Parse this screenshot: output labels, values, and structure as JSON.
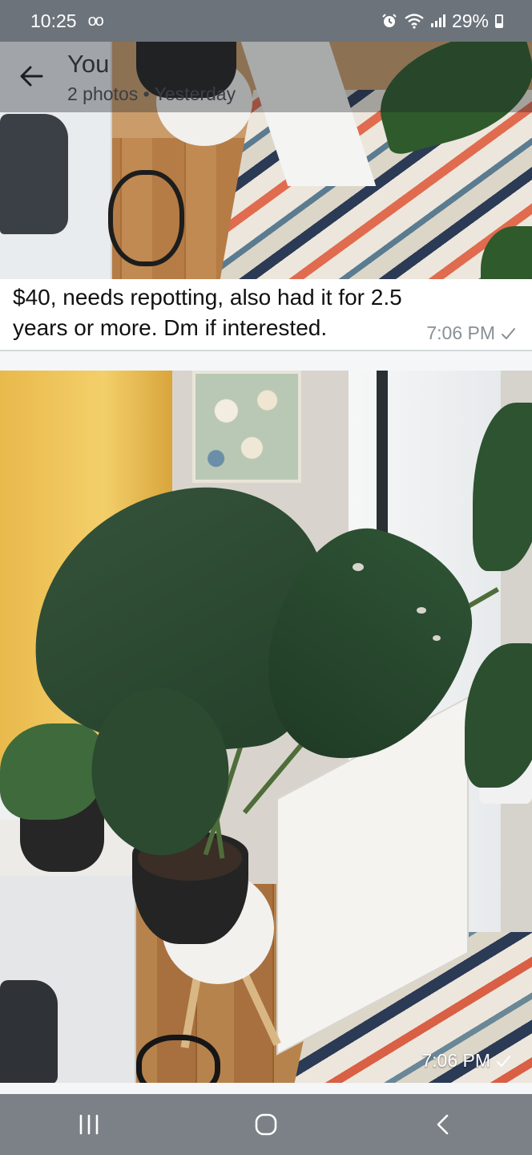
{
  "status_bar": {
    "time": "10:25",
    "voicemail_glyph": "oo",
    "battery": "29%",
    "icons": [
      "alarm-icon",
      "wifi-icon",
      "signal-icon",
      "battery-icon"
    ]
  },
  "header": {
    "title": "You",
    "subtitle": "2 photos • Yesterday",
    "back_icon": "back-arrow-icon"
  },
  "messages": [
    {
      "type": "photo",
      "caption": "$40, needs repotting, also had it for 2.5 years or more. Dm if interested.",
      "time": "7:06 PM",
      "status_icon": "check-icon"
    },
    {
      "type": "photo",
      "time": "7:06 PM",
      "status_icon": "check-icon"
    }
  ],
  "nav_bar": {
    "buttons": [
      "recents-icon",
      "home-icon",
      "back-icon"
    ]
  },
  "colors": {
    "status_bar_bg": "#6c737a",
    "nav_bar_bg": "#7b8186",
    "meta_text": "#8a8f94"
  }
}
